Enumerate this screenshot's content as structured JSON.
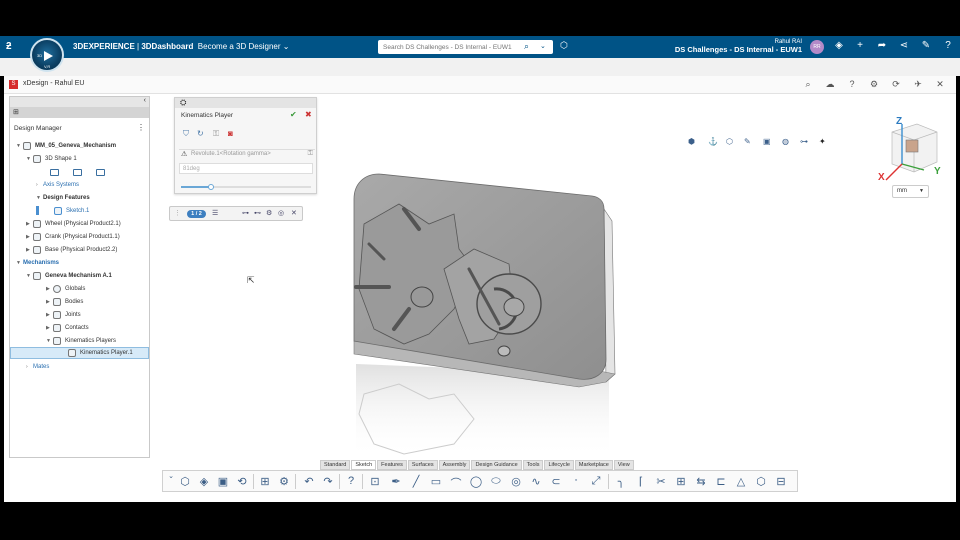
{
  "topbar": {
    "brand_prefix": "3DEXPERIENCE",
    "brand_app": "3DDashboard",
    "dashboard": "Become a 3D Designer",
    "search_placeholder": "Search DS Challenges - DS Internal - EUW1",
    "user_name": "Rahul RAI",
    "tenant": "DS Challenges - DS Internal - EUW1",
    "avatar_initials": "RR"
  },
  "compass": {
    "top": "3D",
    "bottom": "V,R"
  },
  "app": {
    "title": "xDesign - Rahul EU"
  },
  "design_manager": {
    "title": "Design Manager",
    "nodes": [
      {
        "label": "MM_05_Geneva_Mechanism"
      },
      {
        "label": "3D Shape 1"
      },
      {
        "label": "Axis Systems"
      },
      {
        "label": "Design Features"
      },
      {
        "label": "Sketch.1"
      },
      {
        "label": "Wheel (Physical Product2.1)"
      },
      {
        "label": "Crank (Physical Product1.1)"
      },
      {
        "label": "Base (Physical Product2.2)"
      },
      {
        "label": "Mechanisms"
      },
      {
        "label": "Geneva Mechanism A.1"
      },
      {
        "label": "Globals"
      },
      {
        "label": "Bodies"
      },
      {
        "label": "Joints"
      },
      {
        "label": "Contacts"
      },
      {
        "label": "Kinematics Players"
      },
      {
        "label": "Kinematics Player.1"
      },
      {
        "label": "Mates"
      }
    ]
  },
  "kinematics_player": {
    "title": "Kinematics Player",
    "revolute": "Revolute.1<Rotation gamma>",
    "value": "81deg",
    "slider_fraction": 0.23
  },
  "player_bar": {
    "page": "1 / 2"
  },
  "viewcube": {
    "x": "X",
    "y": "Y",
    "z": "Z"
  },
  "units": {
    "selected": "mm"
  },
  "command_tabs": [
    "Standard",
    "Sketch",
    "Features",
    "Surfaces",
    "Assembly",
    "Design Guidance",
    "Tools",
    "Lifecycle",
    "Marketplace",
    "View"
  ],
  "active_tab": "Sketch",
  "colors": {
    "topbar": "#005386",
    "accent": "#3d7fc0",
    "selection": "#d7eaf8"
  }
}
